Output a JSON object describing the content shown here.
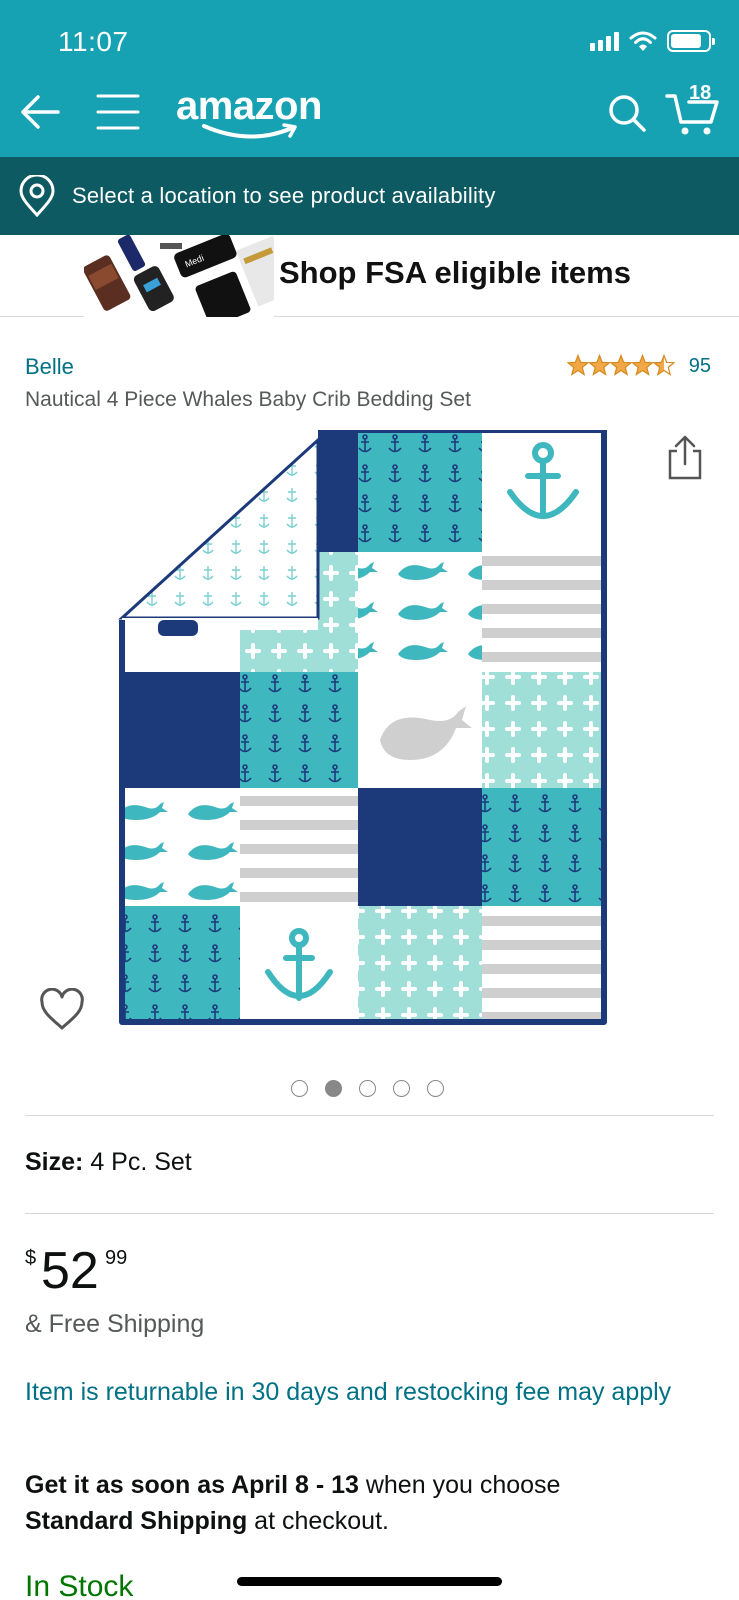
{
  "status_bar": {
    "time": "11:07"
  },
  "header": {
    "logo_text": "amazon",
    "cart_count": "18"
  },
  "location_bar": {
    "text": "Select a location to see product availability"
  },
  "fsa_banner": {
    "text": "Shop FSA eligible items"
  },
  "product": {
    "brand": "Belle",
    "rating_stars": 4.5,
    "rating_count": "95",
    "title": "Nautical 4 Piece Whales Baby Crib Bedding Set",
    "image_dots_total": 5,
    "image_dots_active_index": 1,
    "size_label": "Size:",
    "size_value": "4 Pc. Set",
    "price_symbol": "$",
    "price_whole": "52",
    "price_fraction": "99",
    "shipping": "& Free Shipping",
    "returnable": "Item is returnable in 30 days and restocking fee may apply",
    "delivery_prefix": "Get it as soon as April 8 - 13",
    "delivery_middle": " when you choose ",
    "delivery_method": "Standard Shipping",
    "delivery_suffix": " at checkout.",
    "stock": "In Stock"
  },
  "colors": {
    "header_teal": "#17a2b3",
    "location_dark_teal": "#0e5a62",
    "link_blue": "#007185",
    "star_orange": "#f3a847",
    "stock_green": "#007600",
    "quilt_navy": "#1c3a7a",
    "quilt_teal": "#3fb7bf",
    "quilt_mint": "#a8e2dc",
    "quilt_gray": "#cfcfcf"
  },
  "icons": [
    "back-arrow-icon",
    "menu-icon",
    "search-icon",
    "cart-icon",
    "location-pin-icon",
    "share-icon",
    "heart-icon",
    "star-icon"
  ]
}
